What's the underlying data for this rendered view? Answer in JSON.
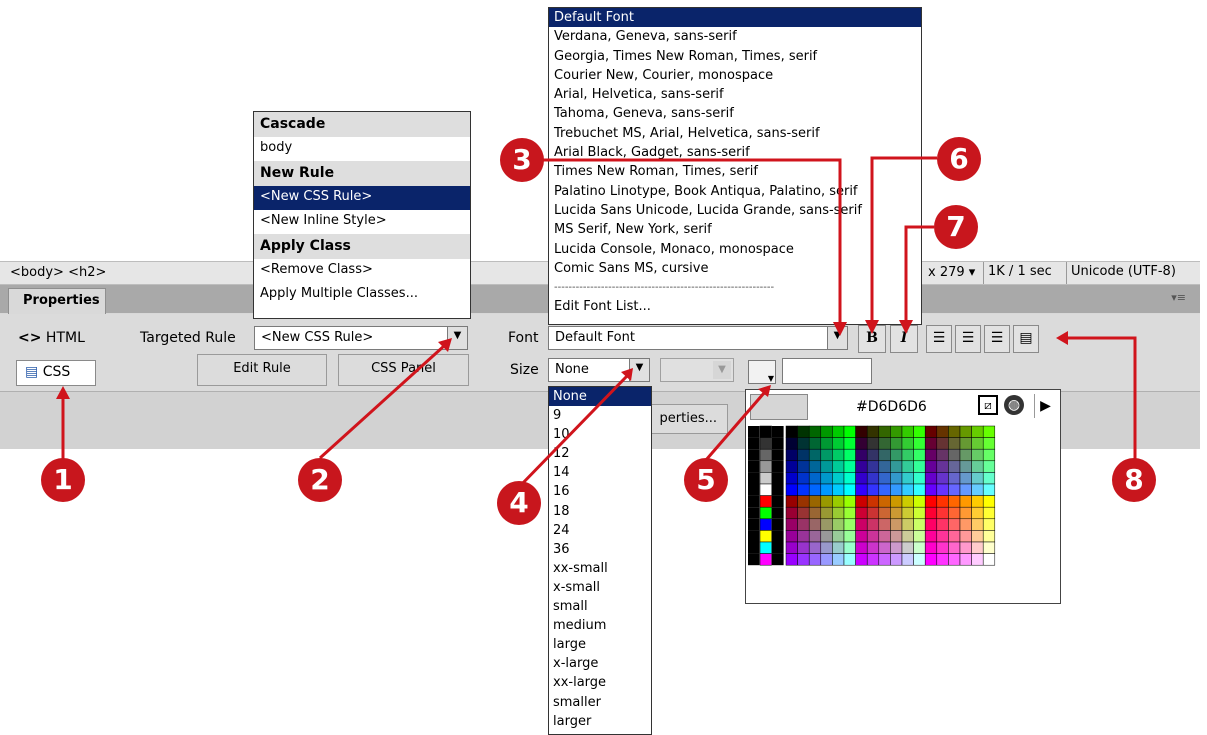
{
  "tag_selector": "<body> <h2>",
  "status": {
    "window_size": "x 279 ▾",
    "doc_size": "1K / 1 sec",
    "encoding": "Unicode (UTF-8)"
  },
  "panel": {
    "title": "Properties"
  },
  "mode": {
    "html_label": "HTML",
    "css_label": "CSS"
  },
  "targeted_rule": {
    "label": "Targeted Rule",
    "value": "<New CSS Rule>"
  },
  "buttons": {
    "edit_rule": "Edit Rule",
    "css_panel": "CSS Panel",
    "page_properties": "perties..."
  },
  "font": {
    "label": "Font",
    "value": "Default Font"
  },
  "size": {
    "label": "Size",
    "value": "None"
  },
  "cascade_menu": {
    "items": [
      {
        "text": "Cascade",
        "kind": "header"
      },
      {
        "text": "body",
        "kind": "item"
      },
      {
        "text": "New Rule",
        "kind": "header"
      },
      {
        "text": "<New CSS Rule>",
        "kind": "selected"
      },
      {
        "text": "<New Inline Style>",
        "kind": "item"
      },
      {
        "text": "Apply Class",
        "kind": "header"
      },
      {
        "text": "<Remove Class>",
        "kind": "item"
      },
      {
        "text": "Apply Multiple Classes...",
        "kind": "item"
      }
    ]
  },
  "font_list": [
    "Default Font",
    "Verdana, Geneva, sans-serif",
    "Georgia, Times New Roman, Times, serif",
    "Courier New, Courier, monospace",
    "Arial, Helvetica, sans-serif",
    "Tahoma, Geneva, sans-serif",
    "Trebuchet MS, Arial, Helvetica, sans-serif",
    "Arial Black, Gadget, sans-serif",
    "Times New Roman, Times, serif",
    "Palatino Linotype, Book Antiqua, Palatino, serif",
    "Lucida Sans Unicode, Lucida Grande, sans-serif",
    "MS Serif, New York, serif",
    "Lucida Console, Monaco, monospace",
    "Comic Sans MS, cursive",
    "-------------------------------------------------------------",
    "Edit Font List..."
  ],
  "size_list": [
    "None",
    "9",
    "10",
    "12",
    "14",
    "16",
    "18",
    "24",
    "36",
    "xx-small",
    "x-small",
    "small",
    "medium",
    "large",
    "x-large",
    "xx-large",
    "smaller",
    "larger"
  ],
  "format_buttons": {
    "bold": "B",
    "italic": "I"
  },
  "color_picker": {
    "hex": "#D6D6D6"
  },
  "callouts": [
    "1",
    "2",
    "3",
    "4",
    "5",
    "6",
    "7",
    "8"
  ],
  "colors": {
    "callout": "#c8161d",
    "selection": "#0a246a",
    "swatch": "#d6d6d6"
  }
}
